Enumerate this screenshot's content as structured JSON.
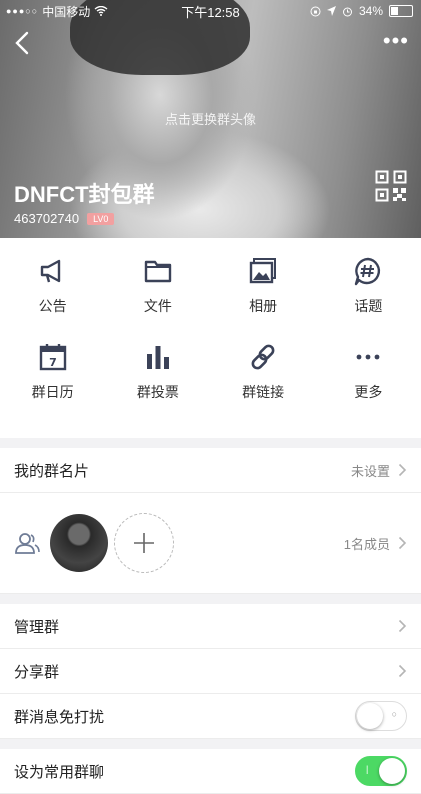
{
  "status_bar": {
    "carrier": "中国移动",
    "time": "下午12:58",
    "battery": "34%"
  },
  "header": {
    "change_avatar": "点击更换群头像",
    "group_name": "DNFCT封包群",
    "group_id": "463702740",
    "level": "LV0"
  },
  "actions": [
    {
      "label": "公告",
      "icon": "megaphone-icon"
    },
    {
      "label": "文件",
      "icon": "folder-icon"
    },
    {
      "label": "相册",
      "icon": "photo-album-icon"
    },
    {
      "label": "话题",
      "icon": "hashtag-icon"
    },
    {
      "label": "群日历",
      "icon": "calendar-icon"
    },
    {
      "label": "群投票",
      "icon": "bar-chart-icon"
    },
    {
      "label": "群链接",
      "icon": "link-icon"
    },
    {
      "label": "更多",
      "icon": "more-icon"
    }
  ],
  "card": {
    "label": "我的群名片",
    "value": "未设置"
  },
  "members": {
    "count": "1名成员"
  },
  "settings": {
    "manage": "管理群",
    "share": "分享群",
    "mute": {
      "label": "群消息免打扰",
      "on": false
    },
    "favorite": {
      "label": "设为常用群聊",
      "on": true
    }
  },
  "colors": {
    "toggle_on": "#4cd964",
    "level_badge": "#f2a0a0"
  }
}
